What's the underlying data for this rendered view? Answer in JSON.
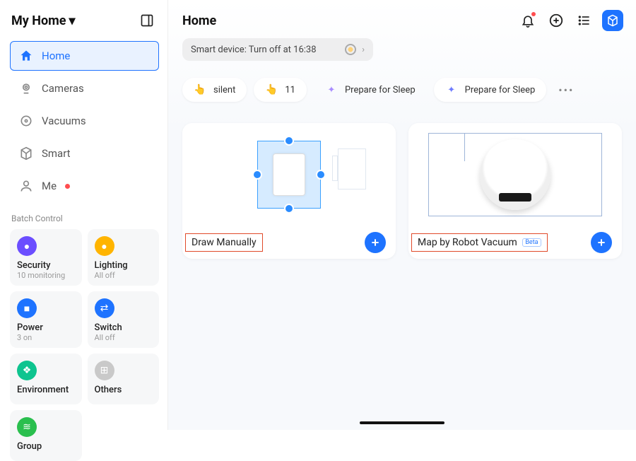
{
  "sidebar": {
    "title": "My Home",
    "nav": [
      {
        "label": "Home"
      },
      {
        "label": "Cameras"
      },
      {
        "label": "Vacuums"
      },
      {
        "label": "Smart"
      },
      {
        "label": "Me"
      }
    ],
    "batch_label": "Batch Control",
    "tiles": [
      {
        "name": "Security",
        "sub": "10 monitoring",
        "color": "#6b4eff",
        "glyph": "●"
      },
      {
        "name": "Lighting",
        "sub": "All off",
        "color": "#ffb400",
        "glyph": "●"
      },
      {
        "name": "Power",
        "sub": "3 on",
        "color": "#1e73ff",
        "glyph": "■"
      },
      {
        "name": "Switch",
        "sub": "All off",
        "color": "#1e73ff",
        "glyph": "⇄"
      },
      {
        "name": "Environment",
        "sub": "",
        "color": "#0ec48f",
        "glyph": "❖"
      },
      {
        "name": "Others",
        "sub": "",
        "color": "#c9c9c9",
        "glyph": "⊞"
      },
      {
        "name": "Group",
        "sub": "",
        "color": "#2abf4e",
        "glyph": "≋"
      }
    ]
  },
  "main": {
    "title": "Home",
    "banner": "Smart device: Turn off at 16:38",
    "scenes": [
      {
        "label": "silent"
      },
      {
        "label": "11"
      },
      {
        "label": "Prepare for Sleep"
      },
      {
        "label": "Prepare for Sleep"
      }
    ],
    "cards": [
      {
        "label": "Draw Manually",
        "beta": ""
      },
      {
        "label": "Map by Robot Vacuum",
        "beta": "Beta"
      }
    ]
  }
}
